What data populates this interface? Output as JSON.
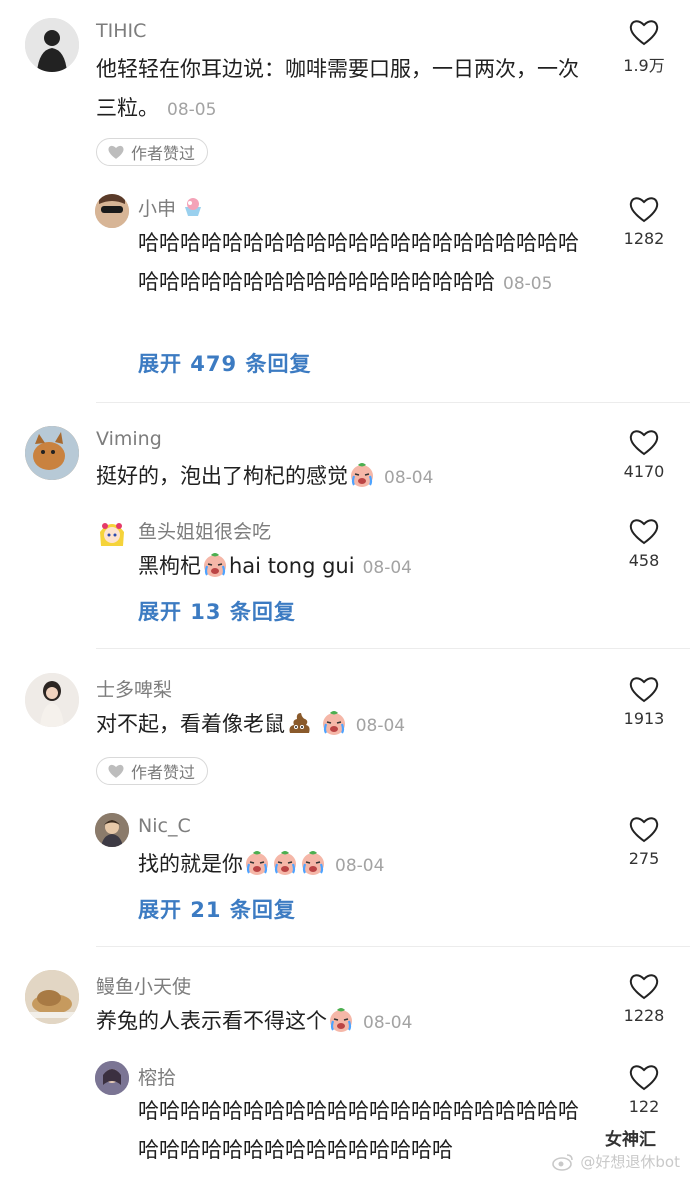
{
  "comments": [
    {
      "username": "TIHIC",
      "text": "他轻轻在你耳边说：咖啡需要口服，一日两次，一次三粒。",
      "date": "08-05",
      "likes": "1.9万",
      "author_liked": "作者赞过",
      "reply": {
        "username": "小申",
        "text": "哈哈哈哈哈哈哈哈哈哈哈哈哈哈哈哈哈哈哈哈哈哈哈哈哈哈哈哈哈哈哈哈哈哈哈哈哈哈",
        "date": "08-05",
        "likes": "1282"
      },
      "expand": "展开 479 条回复"
    },
    {
      "username": "Viming",
      "text": "挺好的，泡出了枸杞的感觉",
      "date": "08-04",
      "likes": "4170",
      "reply": {
        "username": "鱼头姐姐很会吃",
        "text_before": "黑枸杞",
        "text_after": "hai tong gui",
        "date": "08-04",
        "likes": "458"
      },
      "expand": "展开 13 条回复"
    },
    {
      "username": "士多啤梨",
      "text": "对不起，看着像老鼠",
      "date": "08-04",
      "likes": "1913",
      "author_liked": "作者赞过",
      "reply": {
        "username": "Nic_C",
        "text": "找的就是你",
        "date": "08-04",
        "likes": "275"
      },
      "expand": "展开 21 条回复"
    },
    {
      "username": "鳗鱼小天使",
      "text": "养兔的人表示看不得这个",
      "date": "08-04",
      "likes": "1228",
      "reply": {
        "username": "榕拾",
        "text": "哈哈哈哈哈哈哈哈哈哈哈哈哈哈哈哈哈哈哈哈哈哈哈哈哈哈哈哈哈哈哈哈哈哈哈哈",
        "likes": "122"
      }
    }
  ],
  "watermark": {
    "brand": "女神汇",
    "handle": "@好想退休bot"
  },
  "colors": {
    "username": "#7d7d7d",
    "date": "#a3a3a3",
    "link": "#3c7bc2",
    "text": "#1f1f1f"
  },
  "icons": {
    "like": "heart-outline-icon",
    "crying_emoji": "crying-face-emoji",
    "poop_emoji": "poop-emoji",
    "shaved_ice": "shaved-ice-emoji"
  }
}
